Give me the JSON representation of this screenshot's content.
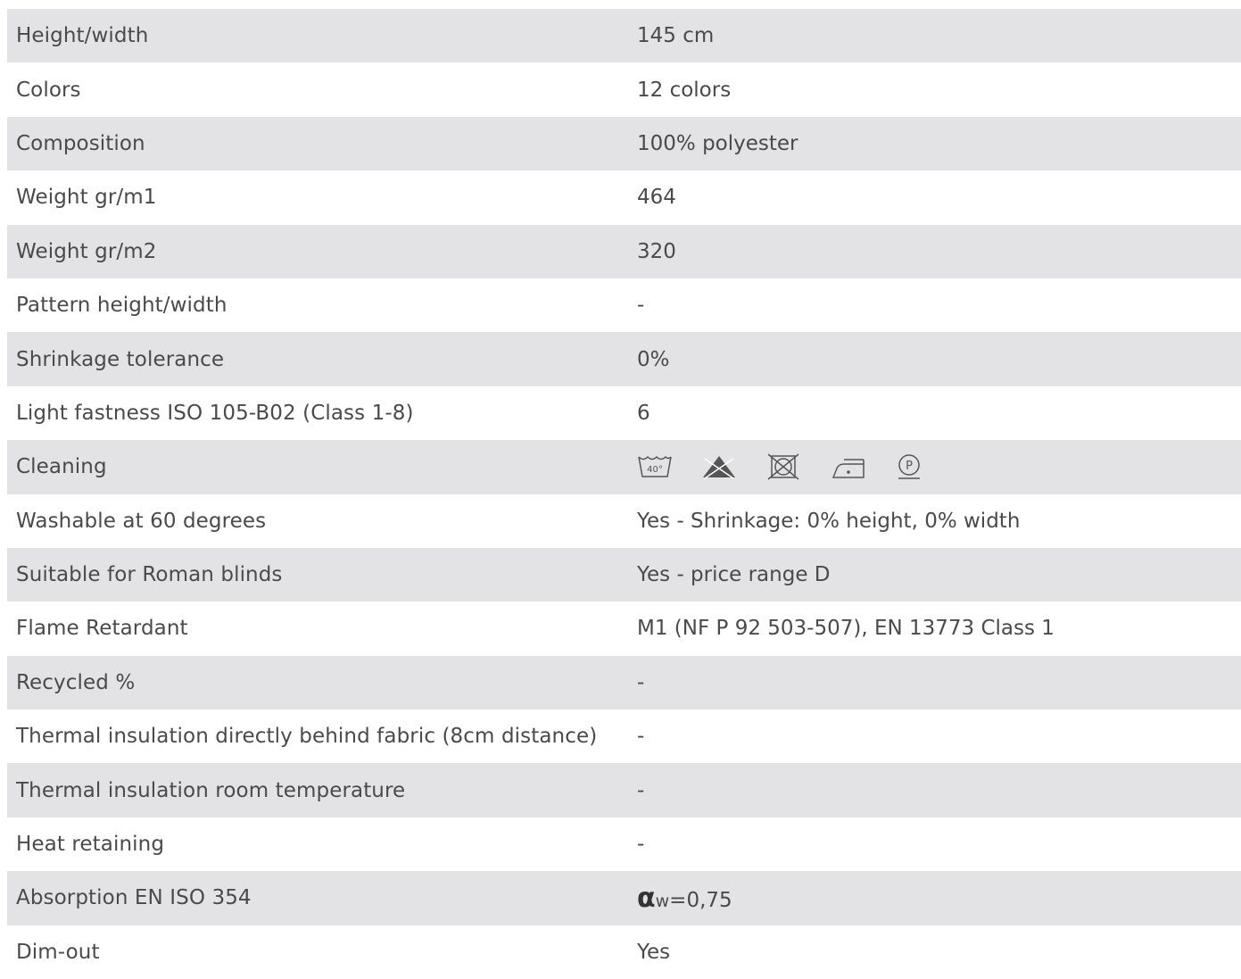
{
  "rows": [
    {
      "label": "Height/width",
      "value": "145 cm"
    },
    {
      "label": "Colors",
      "value": "12 colors"
    },
    {
      "label": "Composition",
      "value": "100% polyester"
    },
    {
      "label": "Weight gr/m1",
      "value": "464"
    },
    {
      "label": "Weight gr/m2",
      "value": "320"
    },
    {
      "label": "Pattern height/width",
      "value": "-"
    },
    {
      "label": "Shrinkage tolerance",
      "value": "0%"
    },
    {
      "label": "Light fastness ISO 105-B02 (Class 1-8)",
      "value": "6"
    },
    {
      "label": "Cleaning",
      "icons": [
        "wash-40-icon",
        "no-bleach-icon",
        "no-tumble-dry-icon",
        "iron-low-icon",
        "dry-clean-p-icon"
      ],
      "wash_temp": "40°",
      "dryclean_letter": "P"
    },
    {
      "label": "Washable at 60 degrees",
      "value": "Yes - Shrinkage: 0% height, 0% width"
    },
    {
      "label": "Suitable for Roman blinds",
      "value": "Yes - price range D"
    },
    {
      "label": "Flame Retardant",
      "value": "M1 (NF P 92 503-507), EN 13773 Class 1"
    },
    {
      "label": "Recycled %",
      "value": "-"
    },
    {
      "label": "Thermal insulation directly behind fabric (8cm distance)",
      "value": "-"
    },
    {
      "label": "Thermal insulation room temperature",
      "value": "-"
    },
    {
      "label": "Heat retaining",
      "value": "-"
    },
    {
      "label": "Absorption EN ISO 354",
      "absorption": {
        "symbol": "α",
        "subscript": "w",
        "value": "=0,75"
      }
    },
    {
      "label": "Dim-out",
      "value": "Yes"
    }
  ],
  "colors": {
    "shaded_row": "#e3e3e5",
    "text": "#4a4a4a",
    "icon": "#555555"
  }
}
